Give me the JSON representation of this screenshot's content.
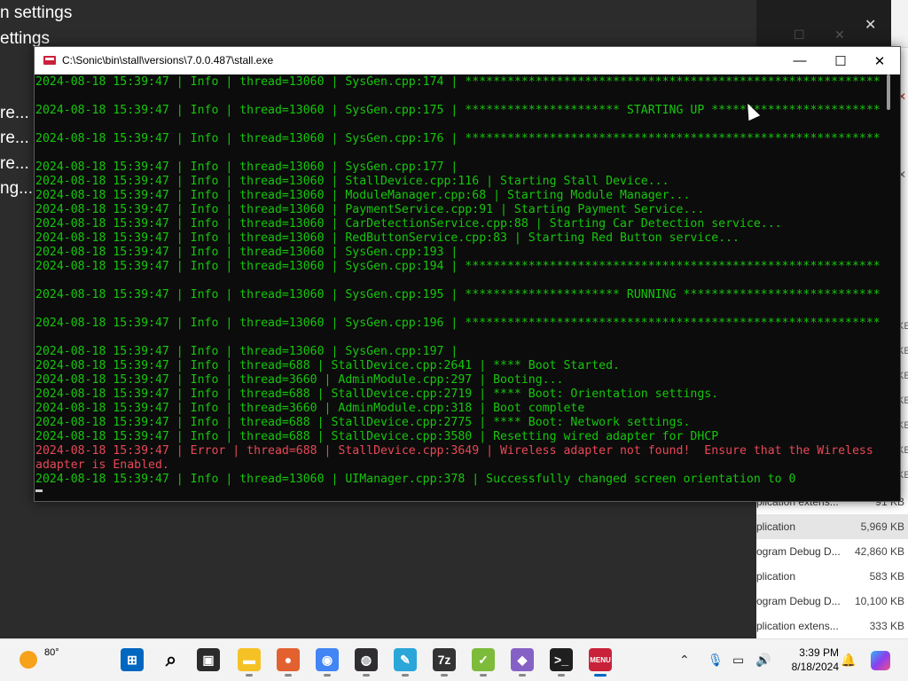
{
  "background_left": {
    "lines": [
      "n settings",
      "ettings",
      "re... M",
      "re... M",
      "re... M",
      "ng..."
    ]
  },
  "background_right": {
    "files": [
      {
        "name": "plication extens...",
        "size": "91 KB"
      },
      {
        "name": "plication",
        "size": "5,969 KB"
      },
      {
        "name": "ogram Debug D...",
        "size": "42,860 KB"
      },
      {
        "name": "plication",
        "size": "583 KB"
      },
      {
        "name": "ogram Debug D...",
        "size": "10,100 KB"
      },
      {
        "name": "plication extens...",
        "size": "333 KB"
      }
    ],
    "kb_labels": [
      "KE",
      "KE",
      "KE",
      "KE",
      "KE",
      "KE",
      "KE",
      "KE",
      "KE"
    ]
  },
  "console": {
    "title": "C:\\Sonic\\bin\\stall\\versions\\7.0.0.487\\stall.exe",
    "lines": [
      {
        "text": "2024-08-18 15:39:47 | Info | thread=13060 | SysGen.cpp:174 | ***********************************************************",
        "level": "info"
      },
      {
        "text": "",
        "level": "info"
      },
      {
        "text": "2024-08-18 15:39:47 | Info | thread=13060 | SysGen.cpp:175 | ********************** STARTING UP ************************",
        "level": "info"
      },
      {
        "text": "",
        "level": "info"
      },
      {
        "text": "2024-08-18 15:39:47 | Info | thread=13060 | SysGen.cpp:176 | ***********************************************************",
        "level": "info"
      },
      {
        "text": "",
        "level": "info"
      },
      {
        "text": "2024-08-18 15:39:47 | Info | thread=13060 | SysGen.cpp:177 |",
        "level": "info"
      },
      {
        "text": "2024-08-18 15:39:47 | Info | thread=13060 | StallDevice.cpp:116 | Starting Stall Device...",
        "level": "info"
      },
      {
        "text": "2024-08-18 15:39:47 | Info | thread=13060 | ModuleManager.cpp:68 | Starting Module Manager...",
        "level": "info"
      },
      {
        "text": "2024-08-18 15:39:47 | Info | thread=13060 | PaymentService.cpp:91 | Starting Payment Service...",
        "level": "info"
      },
      {
        "text": "2024-08-18 15:39:47 | Info | thread=13060 | CarDetectionService.cpp:88 | Starting Car Detection service...",
        "level": "info"
      },
      {
        "text": "2024-08-18 15:39:47 | Info | thread=13060 | RedButtonService.cpp:83 | Starting Red Button service...",
        "level": "info"
      },
      {
        "text": "2024-08-18 15:39:47 | Info | thread=13060 | SysGen.cpp:193 |",
        "level": "info"
      },
      {
        "text": "2024-08-18 15:39:47 | Info | thread=13060 | SysGen.cpp:194 | ***********************************************************",
        "level": "info"
      },
      {
        "text": "",
        "level": "info"
      },
      {
        "text": "2024-08-18 15:39:47 | Info | thread=13060 | SysGen.cpp:195 | ********************** RUNNING ****************************",
        "level": "info"
      },
      {
        "text": "",
        "level": "info"
      },
      {
        "text": "2024-08-18 15:39:47 | Info | thread=13060 | SysGen.cpp:196 | ***********************************************************",
        "level": "info"
      },
      {
        "text": "",
        "level": "info"
      },
      {
        "text": "2024-08-18 15:39:47 | Info | thread=13060 | SysGen.cpp:197 |",
        "level": "info"
      },
      {
        "text": "2024-08-18 15:39:47 | Info | thread=688 | StallDevice.cpp:2641 | **** Boot Started.",
        "level": "info"
      },
      {
        "text": "2024-08-18 15:39:47 | Info | thread=3660 | AdminModule.cpp:297 | Booting...",
        "level": "info"
      },
      {
        "text": "2024-08-18 15:39:47 | Info | thread=688 | StallDevice.cpp:2719 | **** Boot: Orientation settings.",
        "level": "info"
      },
      {
        "text": "2024-08-18 15:39:47 | Info | thread=3660 | AdminModule.cpp:318 | Boot complete",
        "level": "info"
      },
      {
        "text": "2024-08-18 15:39:47 | Info | thread=688 | StallDevice.cpp:2775 | **** Boot: Network settings.",
        "level": "info"
      },
      {
        "text": "2024-08-18 15:39:47 | Info | thread=688 | StallDevice.cpp:3580 | Resetting wired adapter for DHCP",
        "level": "info"
      },
      {
        "text": "2024-08-18 15:39:47 | Error | thread=688 | StallDevice.cpp:3649 | Wireless adapter not found!  Ensure that the Wireless",
        "level": "error"
      },
      {
        "text": "adapter is Enabled.",
        "level": "error"
      },
      {
        "text": "2024-08-18 15:39:47 | Info | thread=13060 | UIManager.cpp:378 | Successfully changed screen orientation to 0",
        "level": "info"
      }
    ]
  },
  "taskbar": {
    "weather_temp": "80°",
    "time": "3:39 PM",
    "date": "8/18/2024",
    "apps": [
      {
        "name": "start-icon",
        "color": "#0067c0",
        "glyph": "⊞"
      },
      {
        "name": "search-icon",
        "color": "#f3f3f3",
        "glyph": "⌕"
      },
      {
        "name": "task-view-icon",
        "color": "#2b2b2b",
        "glyph": "▣"
      },
      {
        "name": "file-explorer-icon",
        "color": "#f5c226",
        "glyph": "▬"
      },
      {
        "name": "firefox-icon",
        "color": "#e2612f",
        "glyph": "●"
      },
      {
        "name": "chrome-icon",
        "color": "#4285f4",
        "glyph": "◉"
      },
      {
        "name": "obs-icon",
        "color": "#302e31",
        "glyph": "◍"
      },
      {
        "name": "paint-icon",
        "color": "#2aa6d9",
        "glyph": "✎"
      },
      {
        "name": "7zip-icon",
        "color": "#333333",
        "glyph": "7z"
      },
      {
        "name": "notepad-plus-icon",
        "color": "#7dbb3b",
        "glyph": "✓"
      },
      {
        "name": "visual-studio-icon",
        "color": "#8661c5",
        "glyph": "◆"
      },
      {
        "name": "terminal-icon",
        "color": "#1f1f1f",
        "glyph": ">_"
      },
      {
        "name": "stall-app-icon",
        "color": "#c9213a",
        "glyph": "MENU"
      }
    ]
  }
}
